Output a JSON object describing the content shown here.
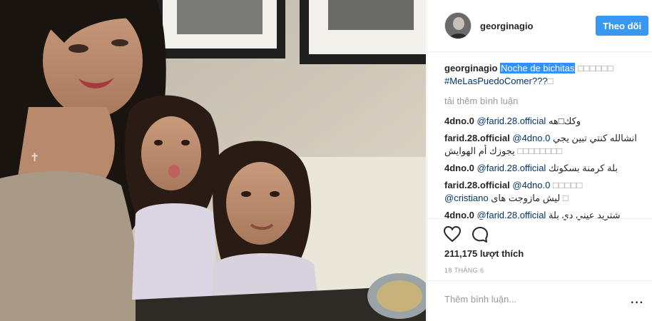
{
  "post": {
    "photo_alt_subject": "selfie",
    "colors": {
      "accent": "#3897f0",
      "mention": "#003569",
      "muted": "#999999",
      "highlight": "#3390ff"
    }
  },
  "header": {
    "username": "georginagio",
    "follow_label": "Theo dõi"
  },
  "caption": {
    "username": "georginagio",
    "highlighted": "Noche de bichitas",
    "boxes": "□□□□□□",
    "hashtag": "#MeLasPuedoComer???",
    "trail_box": "□"
  },
  "load_more": "tải thêm bình luận",
  "comments": [
    {
      "user": "4dno.0",
      "mention": "@farid.28.official",
      "text": "وكك□هه"
    },
    {
      "user": "farid.28.official",
      "mention": "@4dno.0",
      "text": "انشالله كنتي تبين يجي",
      "line2": "يجوزك أم الهوايش",
      "boxes2": "□□□□□□□□"
    },
    {
      "user": "4dno.0",
      "mention": "@farid.28.official",
      "text": "بلة كرمنة بسكوتك"
    },
    {
      "user": "farid.28.official",
      "mention": "@4dno.0",
      "boxes": "□□□□□",
      "mention2": "@cristiano",
      "text2": "ليش مازوجت هاى",
      "box_end": "□"
    },
    {
      "user": "4dno.0",
      "mention": "@farid.28.official",
      "text": "شتريد عيني دي بلة"
    }
  ],
  "icons": {
    "like": "heart-icon",
    "comment": "comment-bubble-icon",
    "more": "more-options-icon"
  },
  "likes": "211,175 lượt thích",
  "date": "18 THÁNG 6",
  "add_comment": {
    "placeholder": "Thêm bình luận...",
    "more": "···"
  }
}
